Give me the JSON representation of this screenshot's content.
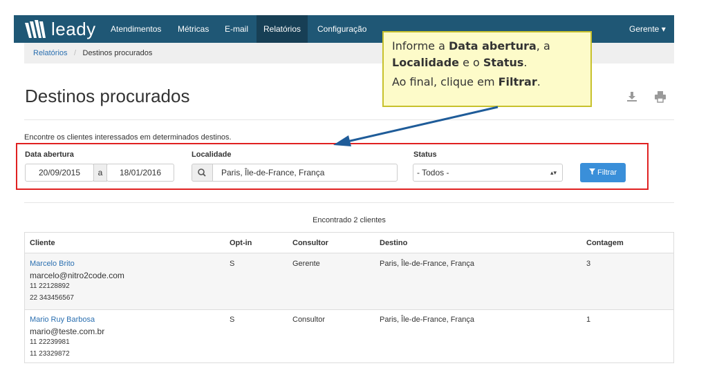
{
  "app": {
    "name": "leady"
  },
  "nav": {
    "items": [
      {
        "label": "Atendimentos"
      },
      {
        "label": "Métricas"
      },
      {
        "label": "E-mail"
      },
      {
        "label": "Relatórios"
      },
      {
        "label": "Configuração"
      }
    ],
    "user": "Gerente ▾"
  },
  "breadcrumb": {
    "parent": "Relatórios",
    "separator": "/",
    "current": "Destinos procurados"
  },
  "page": {
    "title": "Destinos procurados",
    "intro": "Encontre os clientes interessados em determinados destinos."
  },
  "filters": {
    "date_label": "Data abertura",
    "date_from": "20/09/2015",
    "date_sep": "a",
    "date_to": "18/01/2016",
    "locality_label": "Localidade",
    "locality_value": "Paris, Île-de-France, França",
    "status_label": "Status",
    "status_value": "- Todos -",
    "filter_button": "Filtrar"
  },
  "tooltip": {
    "line1_a": "Informe a ",
    "line1_b": "Data abertura",
    "line1_c": ", a",
    "line2_a": "Localidade",
    "line2_b": " e o ",
    "line2_c": "Status",
    "line2_d": ".",
    "line3_a": "Ao final, clique em ",
    "line3_b": "Filtrar",
    "line3_c": "."
  },
  "results": {
    "summary": "Encontrado 2 clientes",
    "headers": [
      "Cliente",
      "Opt-in",
      "Consultor",
      "Destino",
      "Contagem"
    ],
    "rows": [
      {
        "name": "Marcelo Brito",
        "email": "marcelo@nitro2code.com",
        "phone1": "11 22128892",
        "phone2": "22 343456567",
        "optin": "S",
        "consultor": "Gerente",
        "destino": "Paris, Île-de-France, França",
        "contagem": "3"
      },
      {
        "name": "Mario Ruy Barbosa",
        "email": "mario@teste.com.br",
        "phone1": "11 22239981",
        "phone2": "11 23329872",
        "optin": "S",
        "consultor": "Consultor",
        "destino": "Paris, Île-de-France, França",
        "contagem": "1"
      }
    ]
  },
  "colors": {
    "navbar": "#1f5775",
    "highlight": "#e02020",
    "button": "#3a8fd9",
    "tooltip_bg": "#fdfbc9"
  }
}
